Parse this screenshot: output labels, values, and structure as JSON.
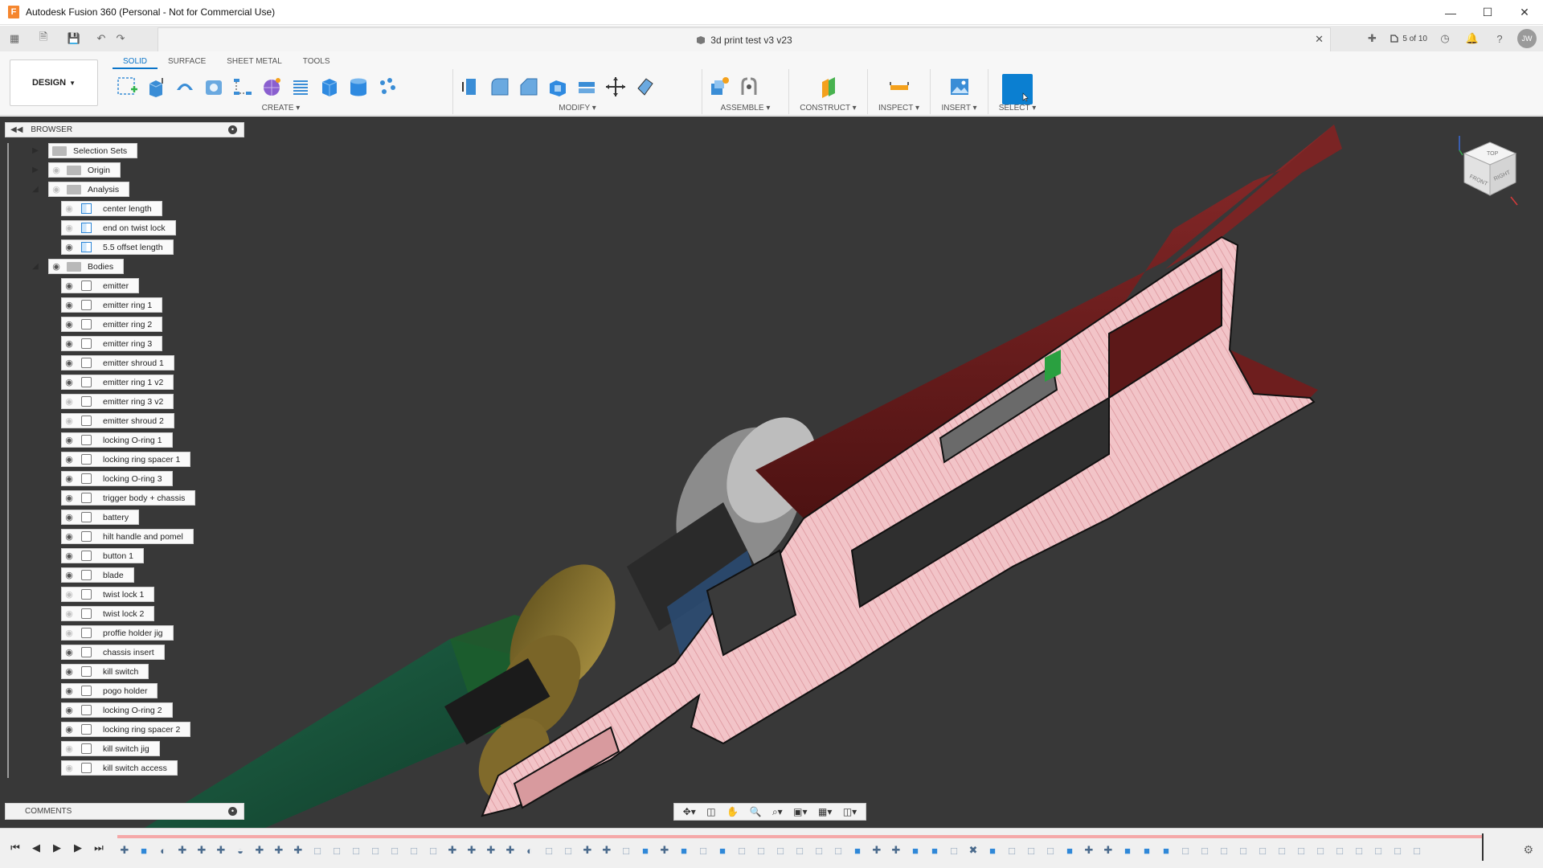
{
  "window": {
    "title": "Autodesk Fusion 360 (Personal - Not for Commercial Use)",
    "logo_letter": "F"
  },
  "document": {
    "tab_title": "3d print test v3 v23",
    "job_status": "5 of 10",
    "user_initials": "JW"
  },
  "toolbar": {
    "workspace_label": "DESIGN",
    "tabs": [
      "SOLID",
      "SURFACE",
      "SHEET METAL",
      "TOOLS"
    ],
    "active_tab": "SOLID",
    "groups": {
      "create": "CREATE",
      "modify": "MODIFY",
      "assemble": "ASSEMBLE",
      "construct": "CONSTRUCT",
      "inspect": "INSPECT",
      "insert": "INSERT",
      "select": "SELECT"
    }
  },
  "browser": {
    "title": "BROWSER",
    "folders": {
      "selection_sets": "Selection Sets",
      "origin": "Origin",
      "analysis": "Analysis",
      "bodies": "Bodies"
    },
    "analysis_items": [
      "center length",
      "end on twist lock",
      "5.5 offset length"
    ],
    "bodies": [
      {
        "name": "emitter",
        "visible": true
      },
      {
        "name": "emitter ring 1",
        "visible": true
      },
      {
        "name": "emitter ring 2",
        "visible": true
      },
      {
        "name": "emitter ring 3",
        "visible": true
      },
      {
        "name": "emitter shroud 1",
        "visible": true
      },
      {
        "name": "emitter ring 1 v2",
        "visible": true
      },
      {
        "name": "emitter ring 3 v2",
        "visible": false
      },
      {
        "name": "emitter shroud 2",
        "visible": false
      },
      {
        "name": "locking O-ring 1",
        "visible": true
      },
      {
        "name": "locking ring spacer 1",
        "visible": true
      },
      {
        "name": "locking O-ring 3",
        "visible": true
      },
      {
        "name": "trigger body + chassis",
        "visible": true
      },
      {
        "name": "battery",
        "visible": true
      },
      {
        "name": "hilt handle and pomel",
        "visible": true
      },
      {
        "name": "button 1",
        "visible": true
      },
      {
        "name": "blade",
        "visible": true
      },
      {
        "name": "twist lock 1",
        "visible": false
      },
      {
        "name": "twist lock 2",
        "visible": false
      },
      {
        "name": "proffie holder jig",
        "visible": false
      },
      {
        "name": "chassis insert",
        "visible": true
      },
      {
        "name": "kill switch",
        "visible": true
      },
      {
        "name": "pogo holder",
        "visible": true
      },
      {
        "name": "locking O-ring 2",
        "visible": true
      },
      {
        "name": "locking ring spacer 2",
        "visible": true
      },
      {
        "name": "kill switch jig",
        "visible": false
      },
      {
        "name": "kill switch access",
        "visible": false
      }
    ]
  },
  "comments": {
    "title": "COMMENTS"
  },
  "viewcube": {
    "faces": [
      "TOP",
      "FRONT",
      "RIGHT"
    ]
  },
  "colors": {
    "accent": "#0a74c8",
    "viewport_bg": "#383838",
    "section_fill": "#f2c4c8",
    "shell_color": "#6b1c1c",
    "timeline_track": "#f5a8a8"
  }
}
